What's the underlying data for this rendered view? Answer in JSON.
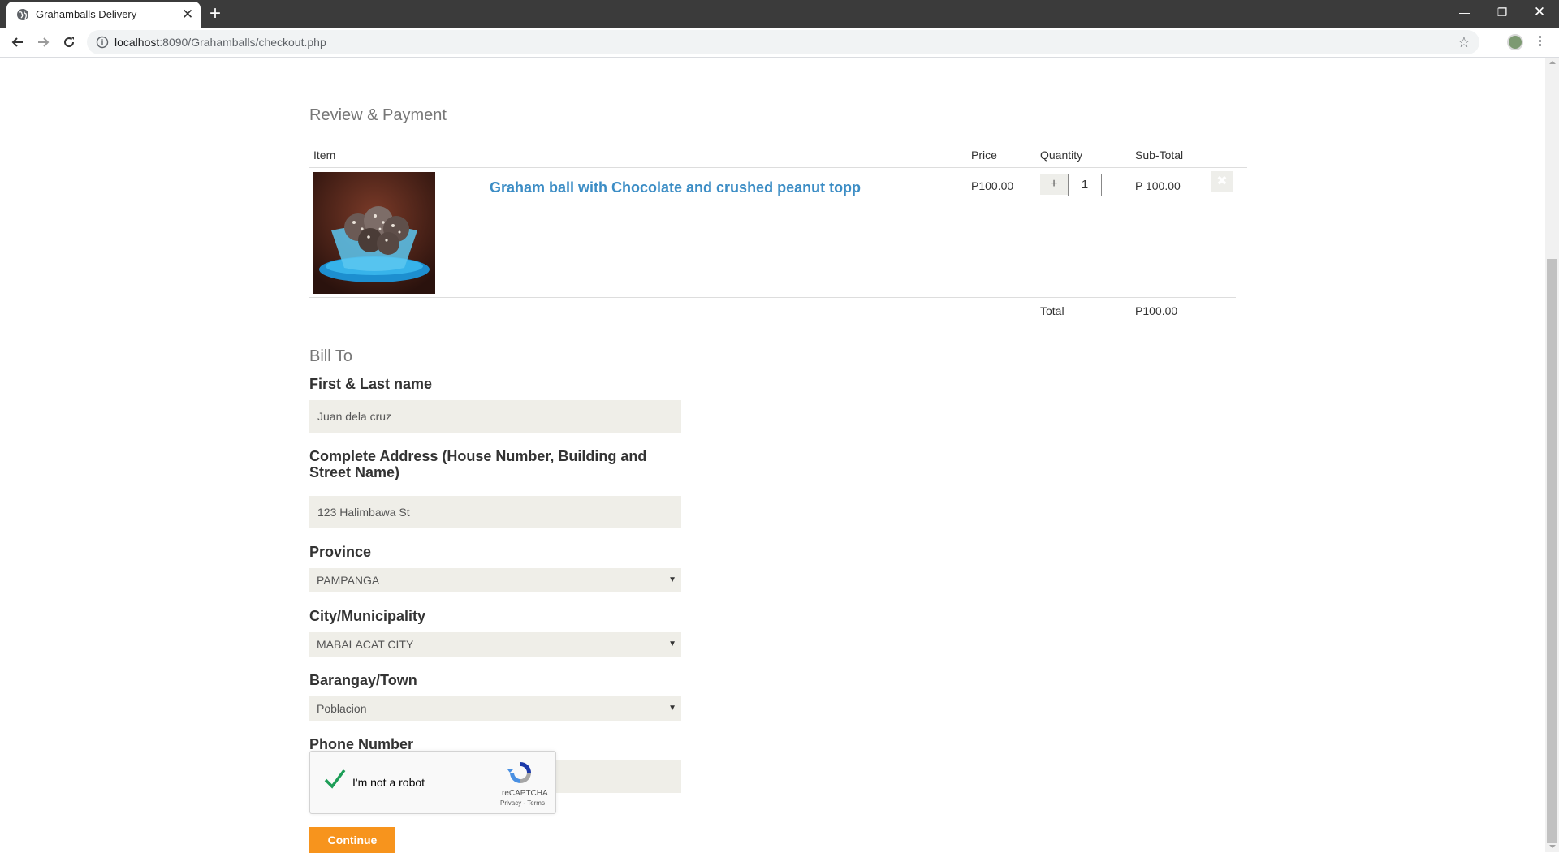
{
  "browser": {
    "tab_title": "Grahamballs Delivery",
    "tab_close": "✕",
    "new_tab": "+",
    "url_host": "localhost",
    "url_path": ":8090/Grahamballs/checkout.php",
    "minimize": "—",
    "restore": "❐",
    "close": "✕"
  },
  "review": {
    "heading": "Review & Payment",
    "columns": {
      "item": "Item",
      "price": "Price",
      "quantity": "Quantity",
      "subtotal": "Sub-Total"
    },
    "items": [
      {
        "name": "Graham ball with Chocolate and crushed peanut topp",
        "price": "P100.00",
        "quantity": "1",
        "plus": "+",
        "subtotal": "P 100.00",
        "remove": "✖"
      }
    ],
    "total_label": "Total",
    "total_value": "P100.00"
  },
  "bill": {
    "heading": "Bill To",
    "name_label": "First & Last name",
    "name_value": "Juan dela cruz",
    "address_label": "Complete Address (House Number, Building and Street Name)",
    "address_value": "123 Halimbawa St",
    "province_label": "Province",
    "province_value": "PAMPANGA",
    "city_label": "City/Municipality",
    "city_value": "MABALACAT CITY",
    "barangay_label": "Barangay/Town",
    "barangay_value": "Poblacion",
    "phone_label": "Phone Number",
    "phone_value": "",
    "select_caret": "▼"
  },
  "captcha": {
    "label": "I'm not a robot",
    "brand": "reCAPTCHA",
    "terms": "Privacy - Terms",
    "checked": true
  },
  "continue_label": "Continue",
  "colors": {
    "link": "#3c8dc5",
    "button": "#f7941d",
    "input_bg": "#efeee8",
    "check": "#1e9e58"
  }
}
